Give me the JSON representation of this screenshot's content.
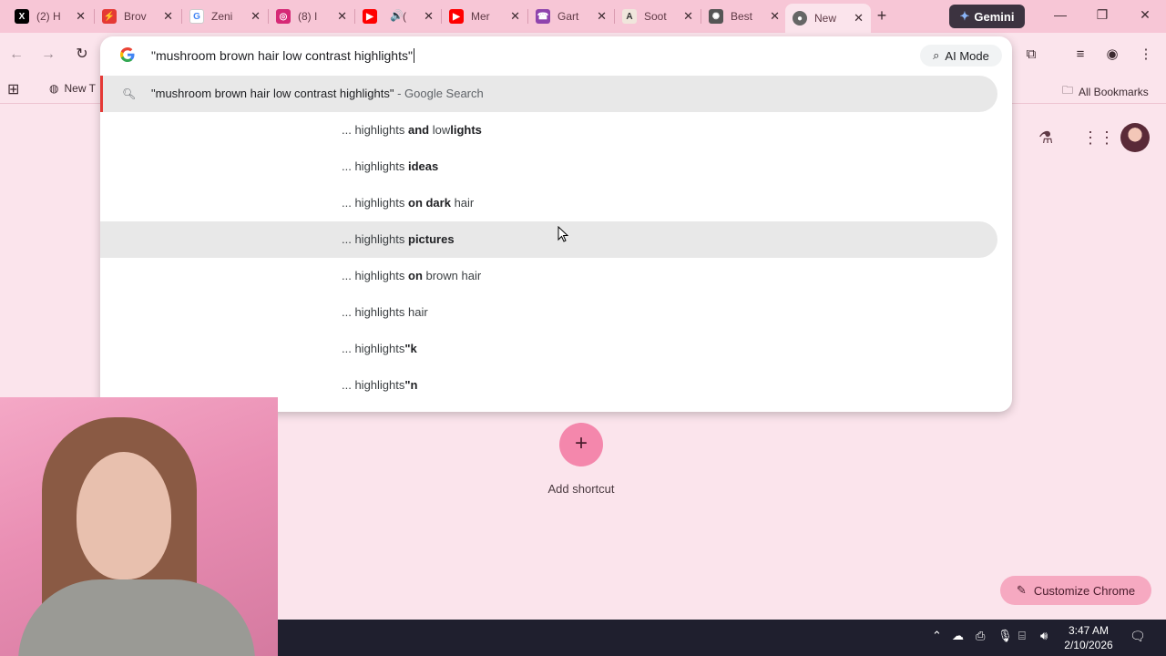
{
  "tabs": [
    {
      "title": "(2) H",
      "icon": "x-icon",
      "color": "#000000"
    },
    {
      "title": "Brov",
      "icon": "bolt-icon",
      "color": "#e53935"
    },
    {
      "title": "Zeni",
      "icon": "google-icon",
      "color": "#4285f4"
    },
    {
      "title": "(8) I",
      "icon": "instagram-icon",
      "color": "#d62976"
    },
    {
      "title": "(",
      "icon": "youtube-icon",
      "color": "#ff0000"
    },
    {
      "title": "Mer",
      "icon": "youtube-icon",
      "color": "#ff0000"
    },
    {
      "title": "Gart",
      "icon": "phone-icon",
      "color": "#8e44ad"
    },
    {
      "title": "Soot",
      "icon": "anthropic-icon",
      "color": "#d4a27f"
    },
    {
      "title": "Best",
      "icon": "openai-icon",
      "color": "#444444"
    },
    {
      "title": "New",
      "icon": "chrome-icon",
      "color": "#555555"
    }
  ],
  "toolbar": {
    "gemini_label": "Gemini",
    "all_bookmarks": "All Bookmarks",
    "bookmark_item": "New T"
  },
  "omnibox": {
    "query": "\"mushroom brown hair low contrast highlights\"",
    "ai_mode_label": "AI Mode",
    "first_suggestion": "\"mushroom brown hair low contrast highlights\"",
    "first_suffix": " - Google Search",
    "suggestions": [
      {
        "prefix": "... highlights ",
        "bold": "and",
        "mid": " low",
        "bold2": "lights"
      },
      {
        "prefix": "... highlights ",
        "bold": "ideas",
        "mid": "",
        "bold2": ""
      },
      {
        "prefix": "... highlights ",
        "bold": "on dark",
        "mid": " hair",
        "bold2": ""
      },
      {
        "prefix": "... highlights ",
        "bold": "pictures",
        "mid": "",
        "bold2": ""
      },
      {
        "prefix": "... highlights ",
        "bold": "on",
        "mid": " brown hair",
        "bold2": ""
      },
      {
        "prefix": "... highlights hair",
        "bold": "",
        "mid": "",
        "bold2": ""
      },
      {
        "prefix": "... highlights",
        "bold": "\"k",
        "mid": "",
        "bold2": ""
      },
      {
        "prefix": "... highlights",
        "bold": "\"n",
        "mid": "",
        "bold2": ""
      }
    ]
  },
  "ntp": {
    "add_shortcut": "Add shortcut",
    "customize": "Customize Chrome"
  },
  "taskbar": {
    "time": "3:47 AM",
    "date": "2/10/2026"
  }
}
